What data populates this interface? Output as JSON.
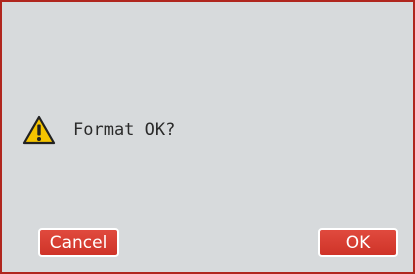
{
  "dialog": {
    "icon": "warning-icon",
    "message": "Format OK?",
    "accent_color": "#d9372c",
    "border_color": "#b0261e",
    "background_color": "#d7dadc"
  },
  "buttons": {
    "cancel_label": "Cancel",
    "ok_label": "OK"
  }
}
